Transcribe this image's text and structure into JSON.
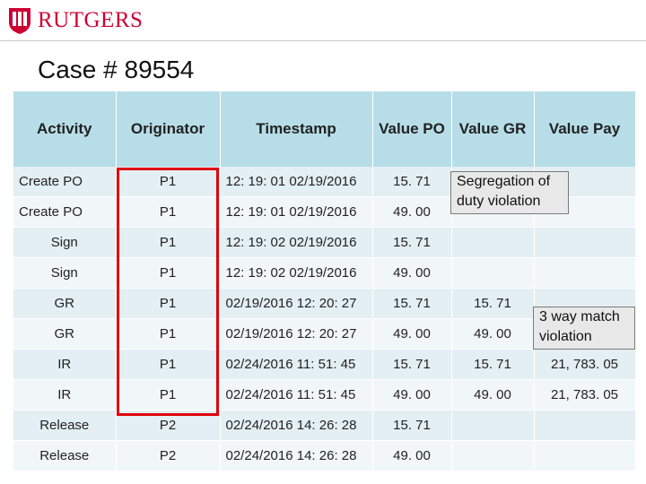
{
  "logo": {
    "text": "RUTGERS"
  },
  "title": "Case # 89554",
  "table": {
    "headers": {
      "activity": "Activity",
      "originator": "Originator",
      "timestamp": "Timestamp",
      "value_po": "Value PO",
      "value_gr": "Value GR",
      "value_pay": "Value Pay"
    },
    "rows": [
      {
        "activity": "Create PO",
        "originator": "P1",
        "timestamp": "12: 19: 01 02/19/2016",
        "value_po": "15. 71",
        "value_gr": "",
        "value_pay": ""
      },
      {
        "activity": "Create PO",
        "originator": "P1",
        "timestamp": "12: 19: 01 02/19/2016",
        "value_po": "49. 00",
        "value_gr": "",
        "value_pay": ""
      },
      {
        "activity": "Sign",
        "originator": "P1",
        "timestamp": "12: 19: 02 02/19/2016",
        "value_po": "15. 71",
        "value_gr": "",
        "value_pay": ""
      },
      {
        "activity": "Sign",
        "originator": "P1",
        "timestamp": "12: 19: 02 02/19/2016",
        "value_po": "49. 00",
        "value_gr": "",
        "value_pay": ""
      },
      {
        "activity": "GR",
        "originator": "P1",
        "timestamp": "02/19/2016 12: 20: 27",
        "value_po": "15. 71",
        "value_gr": "15. 71",
        "value_pay": ""
      },
      {
        "activity": "GR",
        "originator": "P1",
        "timestamp": "02/19/2016 12: 20: 27",
        "value_po": "49. 00",
        "value_gr": "49. 00",
        "value_pay": ""
      },
      {
        "activity": "IR",
        "originator": "P1",
        "timestamp": "02/24/2016 11: 51: 45",
        "value_po": "15. 71",
        "value_gr": "15. 71",
        "value_pay": "21, 783. 05"
      },
      {
        "activity": "IR",
        "originator": "P1",
        "timestamp": "02/24/2016 11: 51: 45",
        "value_po": "49. 00",
        "value_gr": "49. 00",
        "value_pay": "21, 783. 05"
      },
      {
        "activity": "Release",
        "originator": "P2",
        "timestamp": "02/24/2016 14: 26: 28",
        "value_po": "15. 71",
        "value_gr": "",
        "value_pay": ""
      },
      {
        "activity": "Release",
        "originator": "P2",
        "timestamp": "02/24/2016 14: 26: 28",
        "value_po": "49. 00",
        "value_gr": "",
        "value_pay": ""
      }
    ]
  },
  "notes": {
    "sod": "Segregation of duty violation",
    "three_way": "3 way match violation"
  },
  "colors": {
    "brand": "#cc0033",
    "header_fill": "#b7dee8",
    "row_fill_a": "#e3eff3",
    "row_fill_b": "#f1f7f9",
    "highlight_border": "#e0000a"
  }
}
